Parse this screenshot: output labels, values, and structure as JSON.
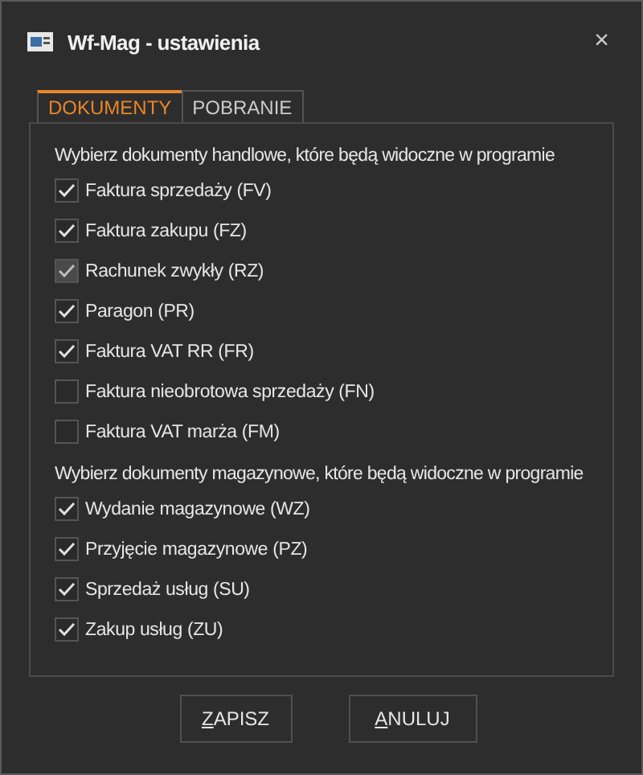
{
  "window": {
    "title": "Wf-Mag - ustawienia",
    "close": "×"
  },
  "tabs": [
    {
      "label": "DOKUMENTY",
      "selected": true
    },
    {
      "label": "POBRANIE",
      "selected": false
    }
  ],
  "sections": [
    {
      "heading": "Wybierz dokumenty handlowe, które będą widoczne w programie",
      "options": [
        {
          "label": "Faktura sprzedaży (FV)",
          "checked": true,
          "disabled": false
        },
        {
          "label": "Faktura zakupu (FZ)",
          "checked": true,
          "disabled": false
        },
        {
          "label": "Rachunek zwykły (RZ)",
          "checked": true,
          "disabled": true
        },
        {
          "label": "Paragon (PR)",
          "checked": true,
          "disabled": false
        },
        {
          "label": "Faktura VAT RR (FR)",
          "checked": true,
          "disabled": false
        },
        {
          "label": "Faktura nieobrotowa sprzedaży (FN)",
          "checked": false,
          "disabled": false
        },
        {
          "label": "Faktura VAT marża (FM)",
          "checked": false,
          "disabled": false
        }
      ]
    },
    {
      "heading": "Wybierz dokumenty magazynowe, które będą widoczne w programie",
      "options": [
        {
          "label": "Wydanie magazynowe (WZ)",
          "checked": true,
          "disabled": false
        },
        {
          "label": "Przyjęcie magazynowe (PZ)",
          "checked": true,
          "disabled": false
        },
        {
          "label": "Sprzedaż usług (SU)",
          "checked": true,
          "disabled": false
        },
        {
          "label": "Zakup usług (ZU)",
          "checked": true,
          "disabled": false
        }
      ]
    }
  ],
  "buttons": [
    {
      "label": "ZAPISZ",
      "first_letter_underlined": true
    },
    {
      "label": "ANULUJ",
      "first_letter_underlined": true
    }
  ]
}
